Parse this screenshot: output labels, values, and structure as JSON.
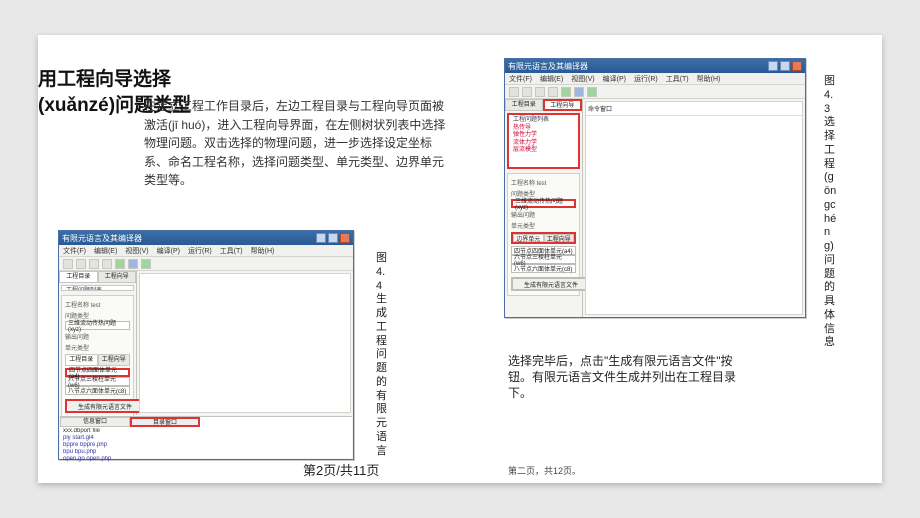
{
  "title_line1": "用工程向导选择",
  "title_line2": "(xuǎnzé)问题类型",
  "body": "在建立工程工作目录后，左边工程目录与工程向导页面被激活(jī huó)，进入工程向导界面，在左侧树状列表中选择物理问题。双击选择的物理问题，进一步选择设定坐标系、命名工程名称，选择问题类型、单元类型、边界单元类型等。",
  "caption_left": "图4.4生成工程问题的有限元语言",
  "caption_right": "图4.3选择工程(gōngchéng)问题的具体信息",
  "text2": "选择完毕后，点击\"生成有限元语言文件\"按钮。有限元语言文件生成并列出在工程目录下。",
  "pager_big": "第2页/共11页",
  "pager_small": "第二页，共12页。",
  "app": {
    "window_title": "有限元语言及其编译器",
    "menus": [
      "文件(F)",
      "编辑(E)",
      "视图(V)",
      "编译(P)",
      "运行(R)",
      "工具(T)",
      "帮助(H)"
    ],
    "tab_dir": "工程目录",
    "tab_wizard": "工程向导",
    "tree": {
      "root": "工程问题列表",
      "items": [
        "热传导",
        "弹性力学",
        "流体力学",
        "层流模型"
      ]
    },
    "form": {
      "name_label": "工程名称    test",
      "probtype_label": "问题类型",
      "probtype_value": "三维流动传热问题(xyz)",
      "disp_label": "输出问题",
      "elem_label": "单元类型",
      "selected_elem": "四节点四面体单元(a4)",
      "other_elem": "六节点三棱柱单元(w6)",
      "other_elem2": "八节点六面体单元(c8)",
      "bnd_label": "边界单元"
    },
    "gen_button": "生成有限元语言文件",
    "log": {
      "tabs": [
        "信息窗口",
        "目录窗口"
      ],
      "lines": [
        "xxx.dbport file",
        "ply   start.gl4",
        "bppre    bppre.php",
        "bpu    bpu.php",
        "open.go   open.php"
      ]
    },
    "cmd_tab": "命令窗口"
  }
}
